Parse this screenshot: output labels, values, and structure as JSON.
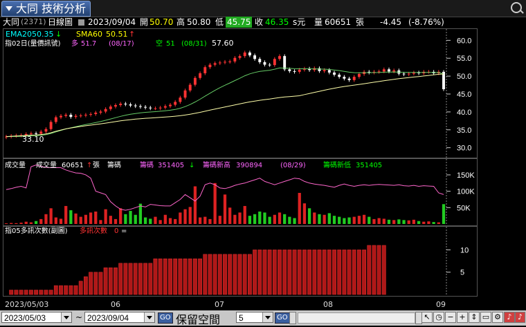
{
  "window": {
    "tab_title": "大同 技術分析"
  },
  "quote": {
    "name": "大同",
    "code": "(2371)",
    "chart_type": "日線圖",
    "date": "2023/09/04",
    "open_label": "開",
    "open": "50.70",
    "high_label": "高",
    "high": "50.80",
    "low_label": "低",
    "low": "45.75",
    "close_label": "收",
    "close": "46.35",
    "close_suffix": "s元",
    "volume_label": "量",
    "volume": "60651",
    "volume_unit": "張",
    "change": "-4.45",
    "change_pct": "(-8.76%)"
  },
  "price_panel": {
    "ema_label": "EMA20",
    "ema_value": "50.35",
    "sma_label": "SMA60",
    "sma_value": "50.51",
    "indicator_label": "指02日(量價訊號)",
    "long_label": "多",
    "long_value": "51.7",
    "long_date": "(08/17)",
    "short_label": "空",
    "short_value": "51",
    "short_date": "(08/31)",
    "max_price": "57.60",
    "min_price": "33.10",
    "y_ticks": [
      "60.0",
      "55.0",
      "50.0",
      "45.0",
      "40.0",
      "35.0",
      "30.0"
    ]
  },
  "volume_panel": {
    "title": "成交量",
    "vol_label": "成交量",
    "vol_value": "60651",
    "vol_unit": "張",
    "chip_label": "籌碼",
    "chip_main_label": "籌碼",
    "chip_main_value": "351405",
    "chip_high_label": "籌碼新高",
    "chip_high_value": "390894",
    "chip_high_date": "(08/29)",
    "chip_low_label": "籌碼新低",
    "chip_low_value": "351405",
    "y_ticks": [
      "150K",
      "100K",
      "50K"
    ]
  },
  "sub_panel": {
    "title": "指05多訊次數(副圖)",
    "series_label": "多訊次數",
    "series_value": "0",
    "y_ticks": [
      "10",
      "5"
    ]
  },
  "x_axis": {
    "labels": [
      "2023/05/03",
      "06",
      "07",
      "08",
      "09"
    ]
  },
  "toolbar": {
    "start_date": "2023/05/03",
    "tilde": "~",
    "end_date": "2023/09/04",
    "go1": "GO",
    "reserve_label": "保留空間",
    "reserve_value": "5",
    "go2": "GO"
  },
  "colors": {
    "up": "#ff3333",
    "down": "#00ff00",
    "ema": "#66cc66",
    "sma": "#ffffaa",
    "chip": "#ff66cc"
  },
  "chart_data": {
    "type": "candlestick",
    "title": "大同 技術分析",
    "price_ylim": [
      28,
      62
    ],
    "volume_ylim": [
      0,
      190000
    ],
    "signal_ylim": [
      0,
      13
    ],
    "close": [
      33.1,
      33.3,
      33.4,
      33.5,
      33.8,
      34.0,
      33.9,
      34.5,
      35.2,
      37.2,
      38.5,
      38.9,
      39.2,
      38.6,
      38.9,
      39.0,
      39.2,
      39.4,
      39.8,
      40.1,
      40.8,
      41.5,
      41.9,
      42.3,
      42.1,
      41.8,
      41.6,
      41.4,
      41.2,
      41.0,
      41.0,
      41.2,
      41.6,
      42.0,
      42.8,
      44.0,
      46.0,
      47.6,
      49.5,
      50.8,
      52.5,
      53.2,
      53.6,
      53.8,
      54.0,
      54.1,
      55.1,
      55.6,
      56.6,
      55.8,
      54.8,
      53.9,
      53.2,
      53.1,
      54.8,
      55.6,
      51.9,
      51.4,
      51.2,
      51.8,
      52.1,
      51.7,
      52.2,
      51.4,
      51.7,
      51.0,
      50.4,
      49.8,
      49.3,
      48.9,
      49.8,
      50.6,
      51.2,
      51.0,
      51.2,
      51.3,
      51.9,
      51.3,
      51.6,
      50.7,
      50.5,
      50.7,
      51.0,
      50.8,
      51.2,
      51.2,
      50.8,
      51.2,
      46.35
    ],
    "volume": [
      2000,
      3000,
      2500,
      4000,
      7000,
      5000,
      9000,
      15000,
      30000,
      48000,
      20000,
      16000,
      55000,
      42000,
      32000,
      22000,
      28000,
      35000,
      38000,
      12000,
      45000,
      25000,
      15000,
      48000,
      30000,
      40000,
      28000,
      62000,
      20000,
      16000,
      22000,
      12000,
      28000,
      18000,
      15000,
      35000,
      45000,
      52000,
      115000,
      20000,
      22000,
      15000,
      125000,
      25000,
      90000,
      50000,
      28000,
      35000,
      55000,
      25000,
      30000,
      38000,
      35000,
      22000,
      28000,
      35000,
      30000,
      22000,
      18000,
      95000,
      63000,
      48000,
      35000,
      30000,
      28000,
      33000,
      25000,
      22000,
      18000,
      20000,
      22000,
      25000,
      28000,
      22000,
      15000,
      18000,
      16000,
      13000,
      12000,
      14000,
      12000,
      11000,
      13000,
      9000,
      7000,
      8000,
      6000,
      5000,
      60651
    ],
    "chip": [
      105000,
      108000,
      112000,
      115000,
      110000,
      175000,
      180000,
      176000,
      173000,
      172000,
      172000,
      172000,
      165000,
      160000,
      156000,
      155000,
      150000,
      140000,
      100000,
      95000,
      90000,
      68000,
      55000,
      45000,
      42000,
      45000,
      50000,
      55000,
      52000,
      60000,
      58000,
      56000,
      55000,
      55000,
      65000,
      75000,
      90000,
      80000,
      70000,
      85000,
      120000,
      125000,
      120000,
      110000,
      108000,
      112000,
      118000,
      122000,
      125000,
      130000,
      135000,
      140000,
      130000,
      125000,
      120000,
      125000,
      130000,
      135000,
      140000,
      138000,
      130000,
      125000,
      122000,
      120000,
      118000,
      115000,
      112000,
      118000,
      122000,
      118000,
      115000,
      118000,
      120000,
      118000,
      120000,
      121000,
      120000,
      119000,
      118000,
      120000,
      117000,
      116000,
      118000,
      115000,
      117000,
      116000,
      115000,
      95000,
      90000
    ],
    "signal": [
      0,
      1,
      1,
      1,
      1,
      1,
      1,
      1,
      1,
      1,
      2,
      2,
      2,
      2,
      2,
      3,
      4,
      5,
      5,
      5,
      6,
      6,
      6,
      7,
      7,
      7,
      7,
      7,
      7,
      7,
      8,
      8,
      8,
      8,
      8,
      8,
      8,
      8,
      8,
      8,
      9,
      9,
      9,
      9,
      9,
      9,
      9,
      9,
      9,
      9,
      10,
      10,
      10,
      10,
      10,
      10,
      10,
      10,
      10,
      10,
      10,
      10,
      10,
      10,
      10,
      10,
      10,
      10,
      10,
      10,
      10,
      10,
      10,
      11,
      11,
      11,
      11,
      0,
      0,
      0,
      0,
      0,
      0,
      0,
      0,
      0,
      0,
      0,
      0
    ]
  }
}
